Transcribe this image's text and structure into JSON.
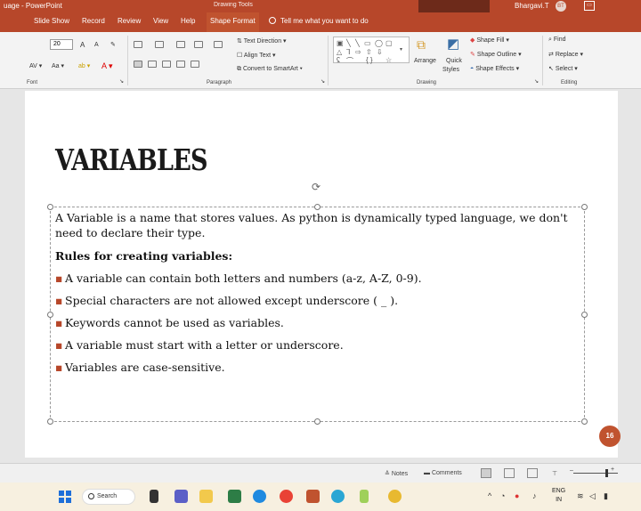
{
  "window": {
    "left_title": "uage - PowerPoint",
    "context_tool": "Drawing Tools",
    "user_name": "Bhargavi.T",
    "user_initials": "BT"
  },
  "tabs": [
    "Slide Show",
    "Record",
    "Review",
    "View",
    "Help",
    "Shape Format"
  ],
  "active_tab": "Shape Format",
  "tell_me": "Tell me what you want to do",
  "ribbon": {
    "font_size": "20",
    "groups": {
      "font": "Font",
      "paragraph": "Paragraph",
      "drawing": "Drawing",
      "editing": "Editing"
    },
    "paragraph_items": [
      "Text Direction",
      "Align Text",
      "Convert to SmartArt"
    ],
    "drawing_items": {
      "arrange": "Arrange",
      "quick_styles_1": "Quick",
      "quick_styles_2": "Styles",
      "shape_fill": "Shape Fill",
      "shape_outline": "Shape Outline",
      "shape_effects": "Shape Effects"
    },
    "editing_items": [
      "Find",
      "Replace",
      "Select"
    ]
  },
  "slide": {
    "title": "VARIABLES",
    "intro": "A Variable is a name that stores values. As python is dynamically typed language, we don't need to declare their type.",
    "rules_heading": "Rules for creating variables:",
    "bullets": [
      "A variable can contain both letters and numbers (a-z, A-Z, 0-9).",
      "Special characters are not allowed except underscore ( _ ).",
      "Keywords cannot be used as variables.",
      "A variable must start with a letter or underscore.",
      "Variables are case-sensitive."
    ],
    "slide_number_badge": "16"
  },
  "statusbar": {
    "notes": "Notes",
    "comments": "Comments"
  },
  "taskbar": {
    "search": "Search",
    "lang_1": "ENG",
    "lang_2": "IN"
  },
  "colors": {
    "accent": "#b7472a",
    "bullet": "#b7472a"
  }
}
